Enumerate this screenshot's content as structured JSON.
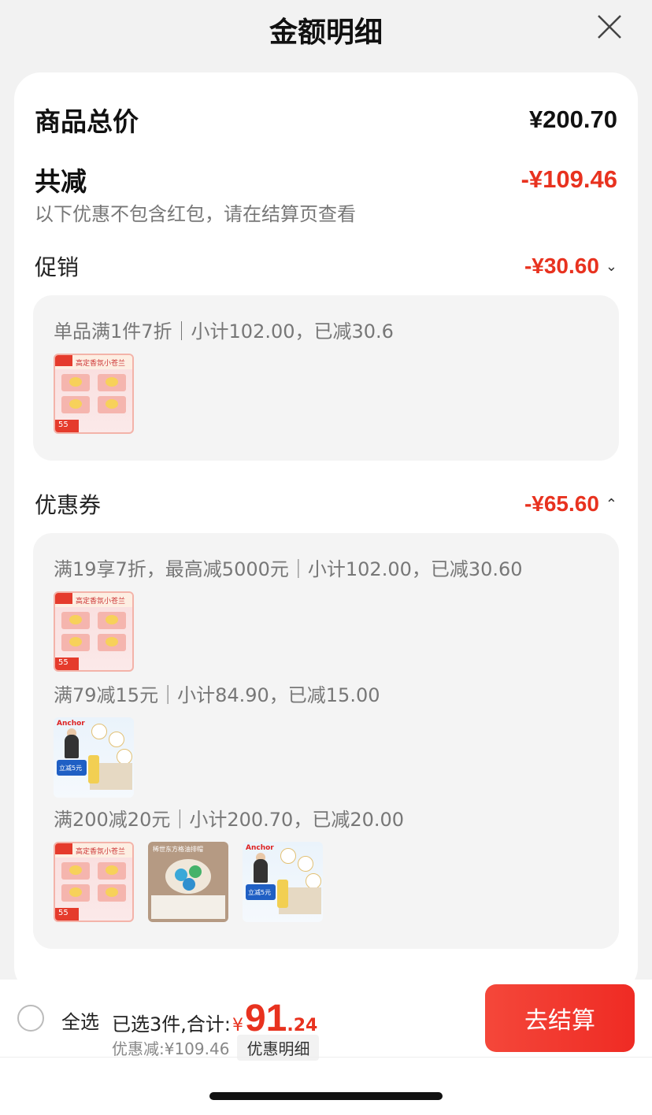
{
  "header": {
    "title": "金额明细"
  },
  "summary": {
    "total_label": "商品总价",
    "total_value": "¥200.70",
    "reduced_label": "共减",
    "reduced_value": "-¥109.46",
    "note": "以下优惠不包含红包，请在结算页查看"
  },
  "promotion": {
    "label": "促销",
    "value": "-¥30.60",
    "chevron": "⌄",
    "rules": [
      {
        "text": "单品满1件7折｜小计102.00，已减30.6",
        "items": [
          "product-a"
        ]
      }
    ]
  },
  "coupons": {
    "label": "优惠券",
    "value": "-¥65.60",
    "chevron": "⌃",
    "rules": [
      {
        "text": "满19享7折，最高减5000元｜小计102.00，已减30.60",
        "items": [
          "product-a"
        ]
      },
      {
        "text": "满79减15元｜小计84.90，已减15.00",
        "items": [
          "product-b"
        ]
      },
      {
        "text": "满200减20元｜小计200.70，已减20.00",
        "items": [
          "product-a",
          "product-c",
          "product-b"
        ]
      }
    ]
  },
  "thumbs": {
    "a_title": "高定香氛小苍兰",
    "a_price": "55",
    "b_logo": "Anchor",
    "b_badge": "立减5元",
    "c_title": "稀世东方格油排帽"
  },
  "bottom": {
    "select_all": "全选",
    "selected_text": "已选3件,合计:",
    "currency": "¥",
    "total_int": "91",
    "total_dec": ".24",
    "discount_text": "优惠减:¥109.46",
    "detail_button": "优惠明细",
    "checkout_button": "去结算"
  },
  "colors": {
    "accent_red": "#e8321f",
    "checkout_red": "#ef2b24"
  }
}
